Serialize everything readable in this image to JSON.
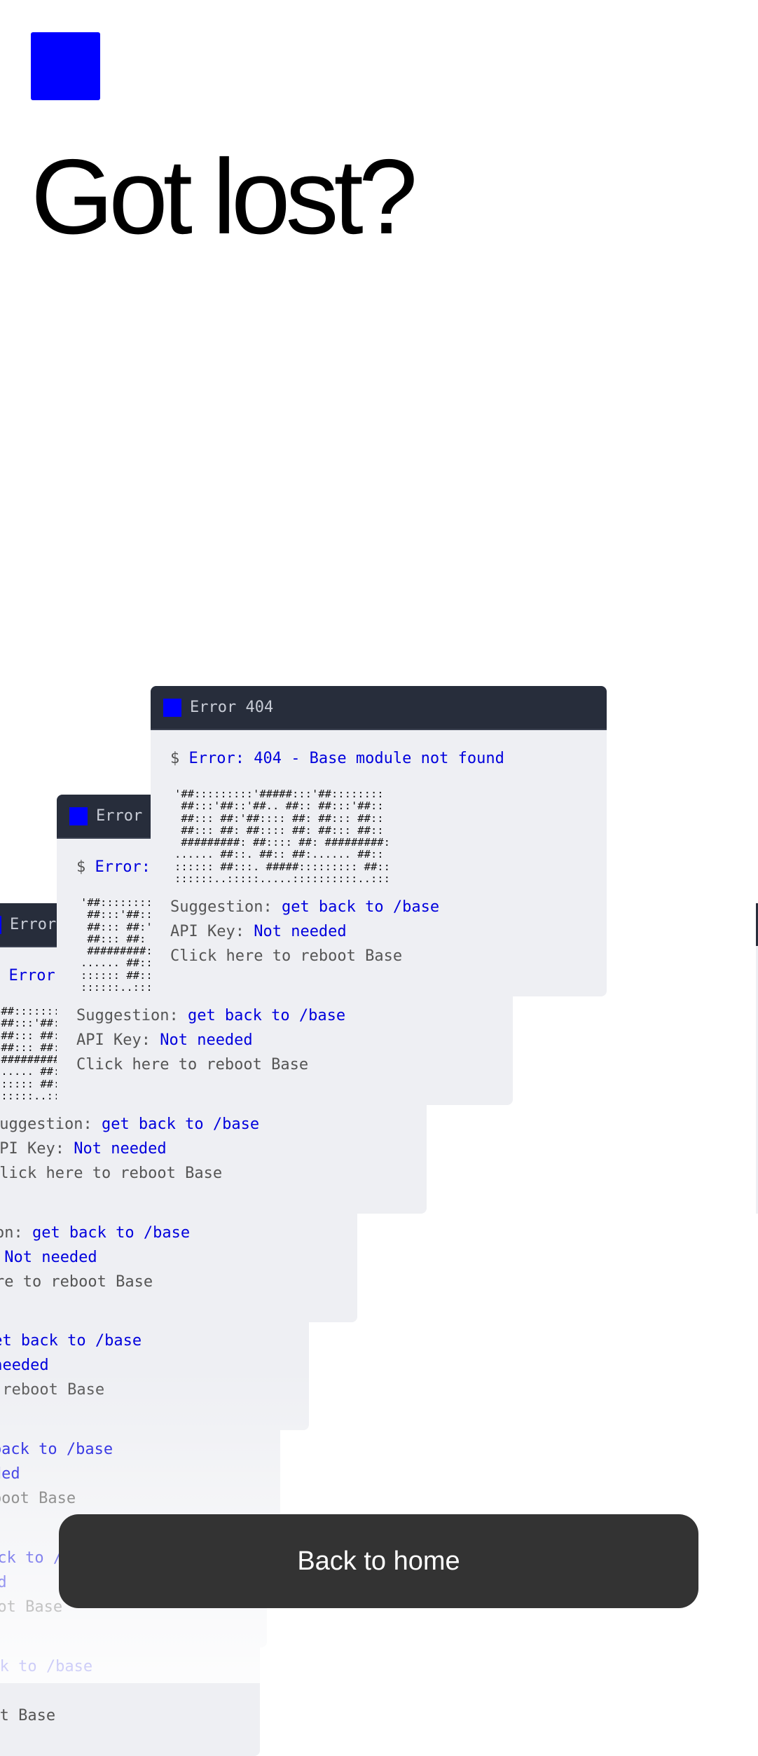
{
  "brand_color": "#0000ff",
  "page": {
    "title": "Got lost?"
  },
  "card": {
    "header": "Error 404",
    "prompt": "$ ",
    "command": "Error: 404 - Base module not found",
    "ascii": [
      "'##:::::::::'#####:::'##::::::::",
      " ##:::'##::'##.. ##:: ##:::'##::",
      " ##::: ##:'##:::: ##: ##::: ##::",
      " ##::: ##: ##:::: ##: ##::: ##::",
      " #########: ##:::: ##: #########:",
      "...... ##::. ##:: ##:...... ##::",
      ":::::: ##:::. #####::::::::: ##::",
      "::::::..:::::.....::::::::::..:::"
    ],
    "suggestion_label": "Suggestion: ",
    "suggestion_value": "get back to /base",
    "api_label": "API Key: ",
    "api_value": "Not needed",
    "reboot": "Click here to reboot Base"
  },
  "button": {
    "label": "Back to home"
  }
}
